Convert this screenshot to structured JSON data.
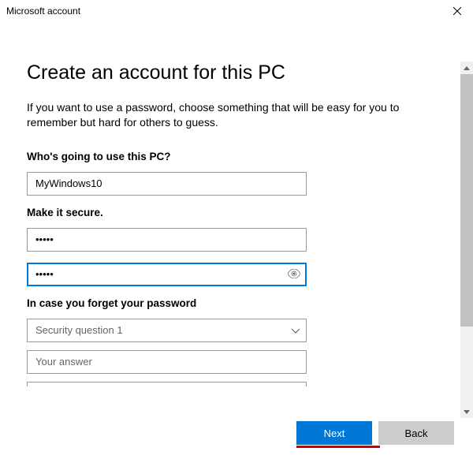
{
  "window": {
    "title": "Microsoft account"
  },
  "dialog": {
    "heading": "Create an account for this PC",
    "intro": "If you want to use a password, choose something that will be easy for you to remember but hard for others to guess.",
    "user_section_label": "Who's going to use this PC?",
    "username_value": "MyWindows10",
    "secure_section_label": "Make it secure.",
    "password_value": "•••••",
    "password_confirm_value": "•••••",
    "forgot_section_label": "In case you forget your password",
    "security_question_placeholder": "Security question 1",
    "answer_placeholder": "Your answer"
  },
  "buttons": {
    "next": "Next",
    "back": "Back"
  }
}
